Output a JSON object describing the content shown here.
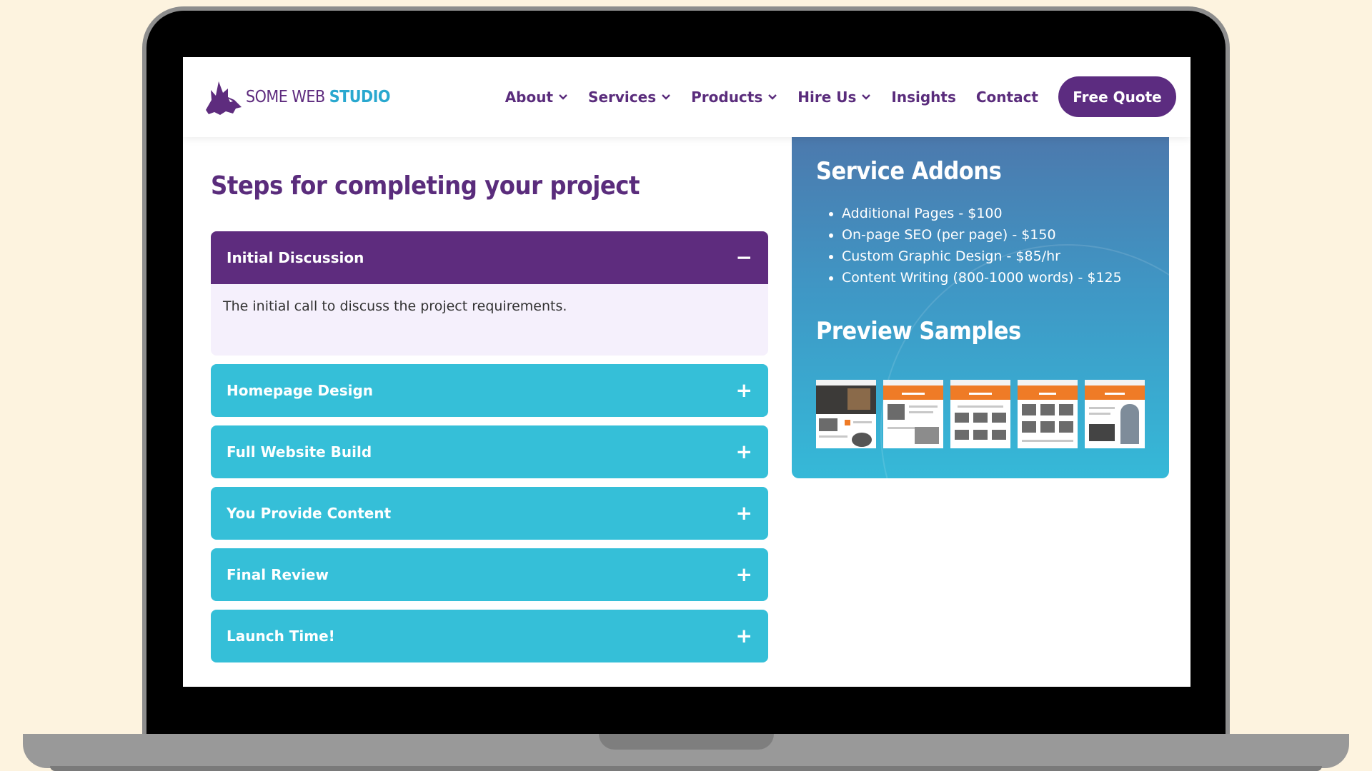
{
  "brand": {
    "name_part1": "SOME WEB ",
    "name_part2": "STUDIO",
    "primary_color": "#5e2c7e",
    "accent_color": "#35bfd8"
  },
  "nav": {
    "items": [
      {
        "label": "About",
        "has_dropdown": true
      },
      {
        "label": "Services",
        "has_dropdown": true
      },
      {
        "label": "Products",
        "has_dropdown": true
      },
      {
        "label": "Hire Us",
        "has_dropdown": true
      },
      {
        "label": "Insights",
        "has_dropdown": false
      },
      {
        "label": "Contact",
        "has_dropdown": false
      }
    ],
    "cta_label": "Free Quote"
  },
  "steps": {
    "title": "Steps for completing your project",
    "items": [
      {
        "label": "Initial Discussion",
        "expanded": true,
        "toggle": "−",
        "body": "The initial call to discuss the project requirements."
      },
      {
        "label": "Homepage Design",
        "expanded": false,
        "toggle": "+"
      },
      {
        "label": "Full Website Build",
        "expanded": false,
        "toggle": "+"
      },
      {
        "label": "You Provide Content",
        "expanded": false,
        "toggle": "+"
      },
      {
        "label": "Final Review",
        "expanded": false,
        "toggle": "+"
      },
      {
        "label": "Launch Time!",
        "expanded": false,
        "toggle": "+"
      }
    ]
  },
  "addons": {
    "title": "Service Addons",
    "items": [
      "Additional Pages - $100",
      "On-page SEO (per page) - $150",
      "Custom Graphic Design - $85/hr",
      "Content Writing (800-1000 words) - $125"
    ]
  },
  "samples": {
    "title": "Preview Samples",
    "count": 5
  }
}
